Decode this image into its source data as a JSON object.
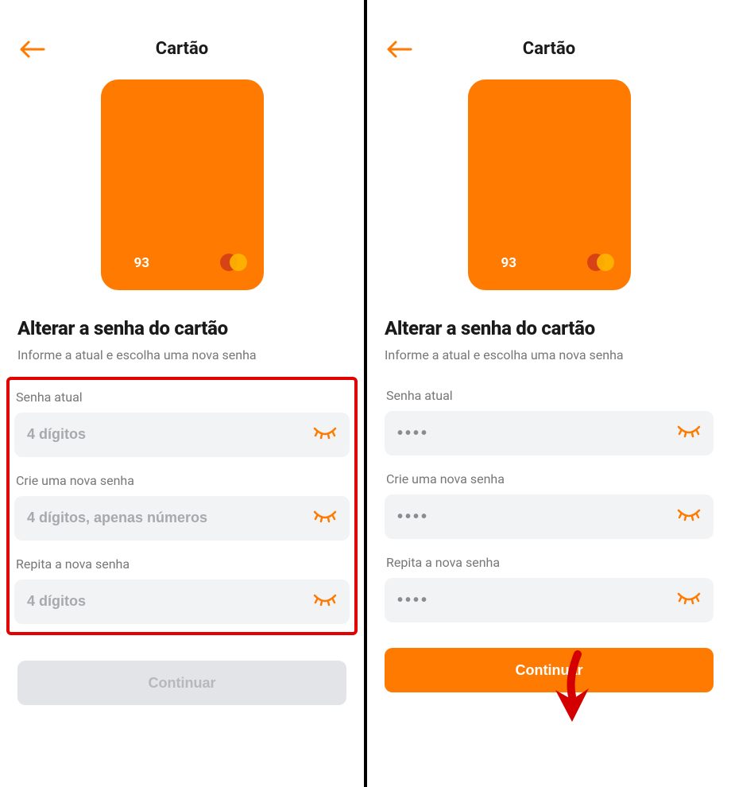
{
  "colors": {
    "accent": "#ff7a00",
    "highlight": "#e30000"
  },
  "left": {
    "header_title": "Cartão",
    "card_number": "93",
    "section_title": "Alterar a senha do cartão",
    "section_sub": "Informe a atual e escolha uma nova senha",
    "fields": {
      "current_label": "Senha atual",
      "current_placeholder": "4 dígitos",
      "current_value": "",
      "new_label": "Crie uma nova senha",
      "new_placeholder": "4 dígitos, apenas números",
      "new_value": "",
      "repeat_label": "Repita a nova senha",
      "repeat_placeholder": "4 dígitos",
      "repeat_value": ""
    },
    "cta_label": "Continuar",
    "cta_enabled": false
  },
  "right": {
    "header_title": "Cartão",
    "card_number": "93",
    "section_title": "Alterar a senha do cartão",
    "section_sub": "Informe a atual e escolha uma nova senha",
    "fields": {
      "current_label": "Senha atual",
      "current_value": "••••",
      "new_label": "Crie uma nova senha",
      "new_value": "••••",
      "repeat_label": "Repita a nova senha",
      "repeat_value": "••••"
    },
    "cta_label": "Continuar",
    "cta_enabled": true
  }
}
